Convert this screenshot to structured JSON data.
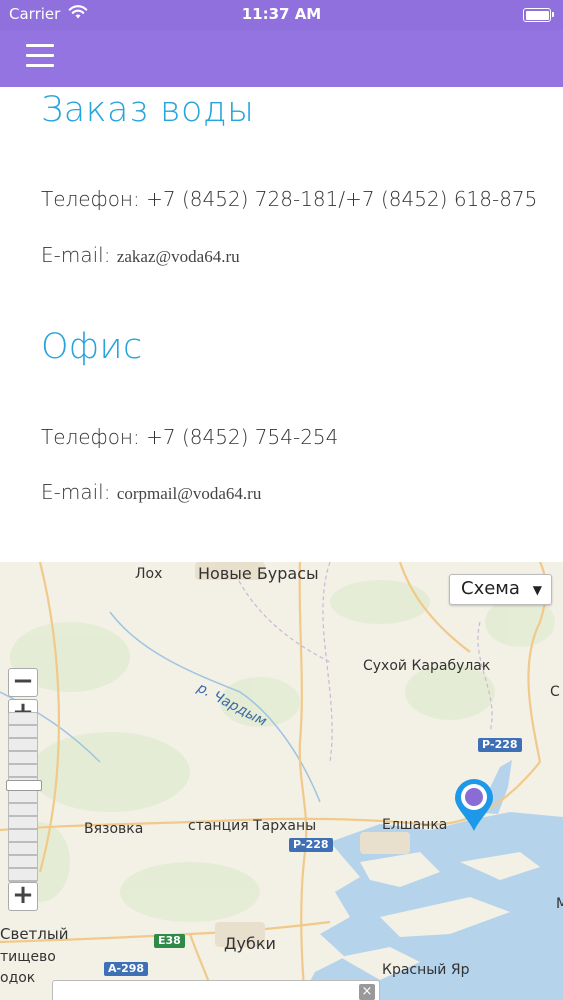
{
  "status_bar": {
    "carrier": "Carrier",
    "time": "11:37 AM"
  },
  "navbar": {
    "menu_icon": "hamburger-menu-icon"
  },
  "order": {
    "title": "Заказ воды",
    "phone_label": "Телефон: ",
    "phone_value": "+7 (8452) 728-181/+7 (8452) 618-875",
    "email_label": "E-mail: ",
    "email_value": "zakaz@voda64.ru"
  },
  "office": {
    "title": "Офис",
    "phone_label": "Телефон: ",
    "phone_value": "+7 (8452) 754-254",
    "email_label": "E-mail: ",
    "email_value": "corpmail@voda64.ru"
  },
  "map": {
    "type_button": "Схема",
    "zoom_out": "−",
    "zoom_in": "+",
    "zoom_in_bottom": "+",
    "labels": {
      "lokh": "Лох",
      "novye_burasy": "Новые Бурасы",
      "sukhoy_karabulak": "Сухой Карабулак",
      "s_edge": "С",
      "chardym": "р. Чардым",
      "vyazovka": "Вязовка",
      "tarkhany": "станция Тарханы",
      "elshanka": "Елшанка",
      "svetly": "Светлый",
      "tishchevo": "тищево",
      "dubki": "Дубки",
      "krasny_yar": "Красный Яр",
      "odok": "одок",
      "m_edge": "М"
    },
    "roads": {
      "r228_top": "Р-228",
      "r228_mid": "Р-228",
      "e38": "E38",
      "a298": "А-298"
    },
    "info_close": "×",
    "colors": {
      "water": "#b5d3ea",
      "land": "#f3f0e6",
      "road": "#f1c98a",
      "marker": "#1e98e8",
      "marker_center": "#8a6cd6"
    }
  }
}
